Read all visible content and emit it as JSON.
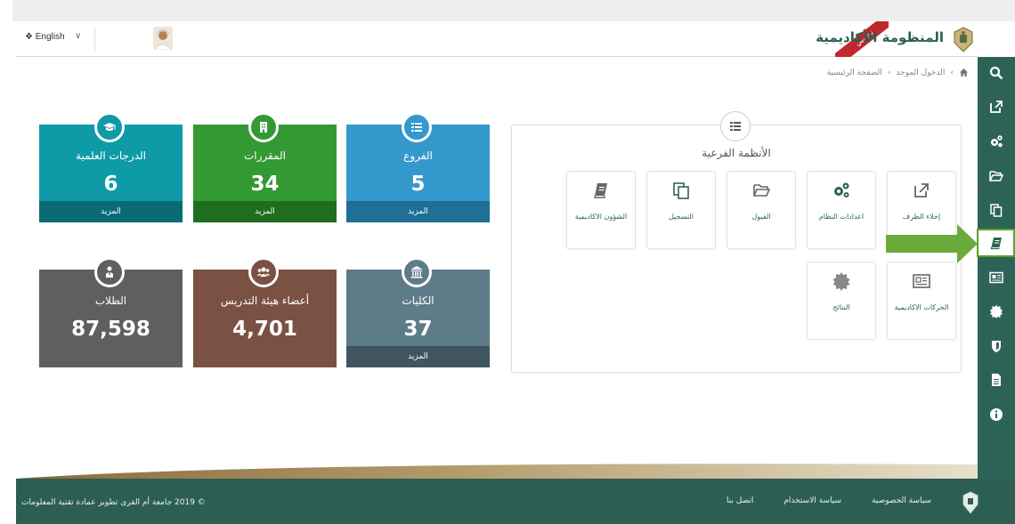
{
  "header": {
    "brand_title": "المنظومة الأكاديمية",
    "trial_label": "تجريبي",
    "language_label": "English",
    "language_icon": "translate-icon"
  },
  "breadcrumb": [
    "الصفحة الرئيسية",
    "الدخول الموحد"
  ],
  "stats": [
    {
      "title": "الفروع",
      "value": "5",
      "more": "المزيد",
      "icon": "list-icon"
    },
    {
      "title": "المقررات",
      "value": "34",
      "more": "المزيد",
      "icon": "building-icon"
    },
    {
      "title": "الدرجات العلمية",
      "value": "6",
      "more": "المزيد",
      "icon": "graduation-cap-icon"
    },
    {
      "title": "الكليات",
      "value": "37",
      "more": "المزيد",
      "icon": "institution-icon"
    },
    {
      "title": "أعضاء هيئة التدريس",
      "value": "4,701",
      "more": "",
      "icon": "users-icon"
    },
    {
      "title": "الطلاب",
      "value": "87,598",
      "more": "",
      "icon": "student-icon"
    }
  ],
  "subsystems": {
    "title": "الأنظمة الفرعية",
    "tiles": [
      {
        "label": "إخلاء الطرف",
        "icon": "external-link-icon"
      },
      {
        "label": "اعدادات النظام",
        "icon": "gears-icon"
      },
      {
        "label": "القبول",
        "icon": "folder-open-icon"
      },
      {
        "label": "التسجيل",
        "icon": "copy-icon"
      },
      {
        "label": "الشؤون الاكاديمية",
        "icon": "book-icon"
      },
      {
        "label": "الحركات الاكاديمية",
        "icon": "newspaper-icon"
      },
      {
        "label": "النتائج",
        "icon": "certificate-icon"
      }
    ]
  },
  "sidebar": [
    "search-icon",
    "external-link-icon",
    "gears-icon",
    "folder-open-icon",
    "copy-icon",
    "book-icon",
    "newspaper-icon",
    "certificate-icon",
    "shield-icon",
    "file-icon",
    "info-icon"
  ],
  "footer": {
    "copyright": "© 2019 جامعة أم القرى تطوير عمادة تقنية المعلومات",
    "links": [
      "سياسة الخصوصية",
      "سياسة الاستخدام",
      "اتصل بنا"
    ]
  },
  "colors": {
    "primary": "#2d6356",
    "blue": "#3399cc",
    "green": "#339933",
    "teal": "#0f9aa8",
    "slate": "#5e7b88",
    "brown": "#7a5143",
    "gray": "#5f5f5f",
    "arrow": "#6aaa3a"
  }
}
